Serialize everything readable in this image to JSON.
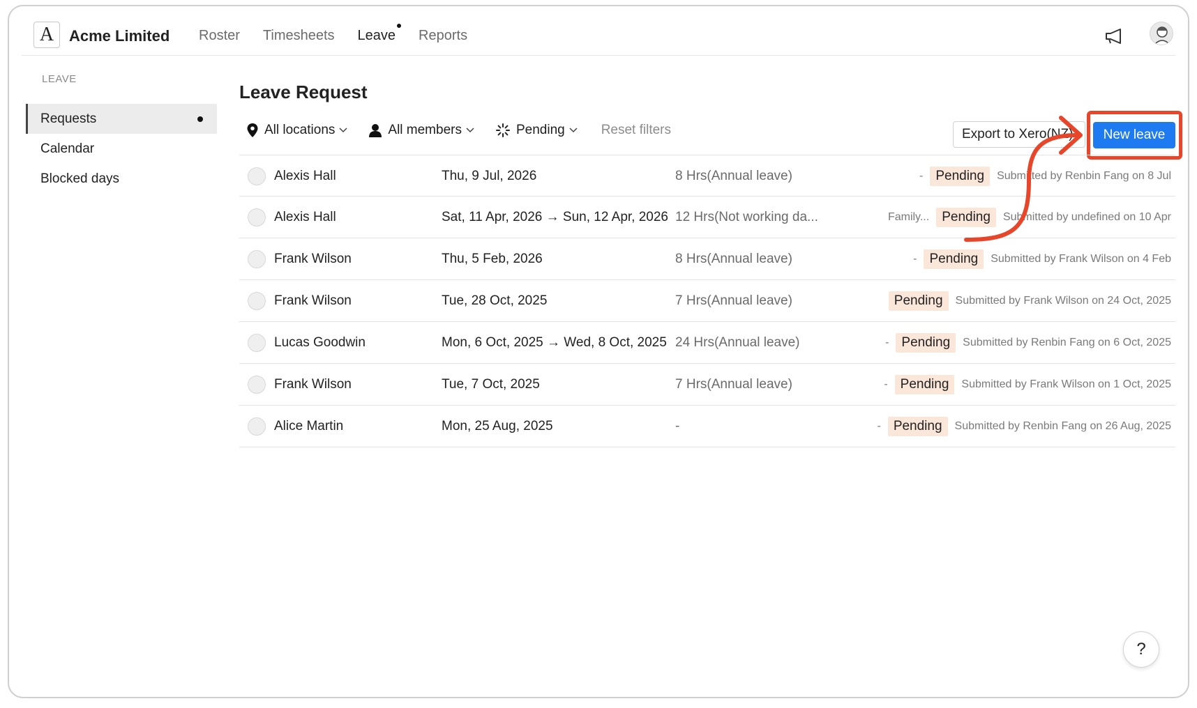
{
  "org": {
    "name": "Acme Limited",
    "logo_letter": "A"
  },
  "nav": {
    "items": [
      {
        "label": "Roster",
        "active": false
      },
      {
        "label": "Timesheets",
        "active": false
      },
      {
        "label": "Leave",
        "active": true
      },
      {
        "label": "Reports",
        "active": false
      }
    ]
  },
  "sidebar": {
    "section": "LEAVE",
    "items": [
      {
        "label": "Requests",
        "active": true
      },
      {
        "label": "Calendar",
        "active": false
      },
      {
        "label": "Blocked days",
        "active": false
      }
    ]
  },
  "main": {
    "title": "Leave Request",
    "filters": {
      "location": "All locations",
      "members": "All members",
      "status": "Pending",
      "reset": "Reset filters"
    },
    "export_label": "Export to Xero(NZ)",
    "new_label": "New leave"
  },
  "rows": [
    {
      "name": "Alexis Hall",
      "date": "Thu, 9 Jul, 2026",
      "hours": "8 Hrs(Annual leave)",
      "note": "-",
      "status": "Pending",
      "submitted": "Submitted by Renbin Fang on 8 Jul"
    },
    {
      "name": "Alexis Hall",
      "date": "Sat, 11 Apr, 2026 → Sun, 12 Apr, 2026",
      "hours": "12 Hrs(Not working da...",
      "note": "Family...",
      "status": "Pending",
      "submitted": "Submitted by undefined on 10 Apr"
    },
    {
      "name": "Frank Wilson",
      "date": "Thu, 5 Feb, 2026",
      "hours": "8 Hrs(Annual leave)",
      "note": "-",
      "status": "Pending",
      "submitted": "Submitted by Frank Wilson on 4 Feb"
    },
    {
      "name": "Frank Wilson",
      "date": "Tue, 28 Oct, 2025",
      "hours": "7 Hrs(Annual leave)",
      "note": "",
      "status": "Pending",
      "submitted": "Submitted by Frank Wilson on 24 Oct, 2025"
    },
    {
      "name": "Lucas Goodwin",
      "date": "Mon, 6 Oct, 2025 → Wed, 8 Oct, 2025",
      "hours": "24 Hrs(Annual leave)",
      "note": "-",
      "status": "Pending",
      "submitted": "Submitted by Renbin Fang on 6 Oct, 2025"
    },
    {
      "name": "Frank Wilson",
      "date": "Tue, 7 Oct, 2025",
      "hours": "7 Hrs(Annual leave)",
      "note": "-",
      "status": "Pending",
      "submitted": "Submitted by Frank Wilson on 1 Oct, 2025"
    },
    {
      "name": "Alice Martin",
      "date": "Mon, 25 Aug, 2025",
      "hours": "-",
      "note": "-",
      "status": "Pending",
      "submitted": "Submitted by Renbin Fang on 26 Aug, 2025"
    }
  ],
  "help": {
    "label": "?"
  },
  "colors": {
    "primary": "#1e7af0",
    "highlight": "#e8462a",
    "badge_bg": "#fbe6da"
  }
}
